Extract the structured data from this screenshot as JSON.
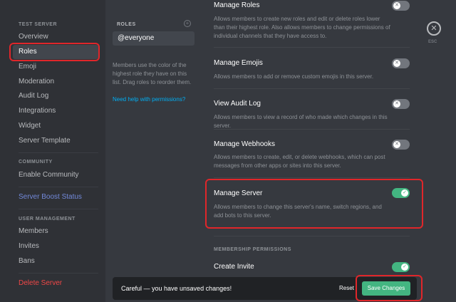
{
  "sidebar": {
    "server_header": "TEST SERVER",
    "items": [
      {
        "label": "Overview"
      },
      {
        "label": "Roles"
      },
      {
        "label": "Emoji"
      },
      {
        "label": "Moderation"
      },
      {
        "label": "Audit Log"
      },
      {
        "label": "Integrations"
      },
      {
        "label": "Widget"
      },
      {
        "label": "Server Template"
      }
    ],
    "community_header": "COMMUNITY",
    "enable_community": "Enable Community",
    "boost_status": "Server Boost Status",
    "user_mgmt_header": "USER MANAGEMENT",
    "user_items": [
      {
        "label": "Members"
      },
      {
        "label": "Invites"
      },
      {
        "label": "Bans"
      }
    ],
    "delete_server": "Delete Server"
  },
  "roles_panel": {
    "header": "ROLES",
    "add_icon": "plus-circle-icon",
    "selected_role": "@everyone",
    "description": "Members use the color of the highest role they have on this list. Drag roles to reorder them.",
    "help_link": "Need help with permissions?"
  },
  "permissions": [
    {
      "title": "Manage Roles",
      "description": "Allows members to create new roles and edit or delete roles lower than their highest role. Also allows members to change permissions of individual channels that they have access to.",
      "enabled": false
    },
    {
      "title": "Manage Emojis",
      "description": "Allows members to add or remove custom emojis in this server.",
      "enabled": false
    },
    {
      "title": "View Audit Log",
      "description": "Allows members to view a record of who made which changes in this server.",
      "enabled": false
    },
    {
      "title": "Manage Webhooks",
      "description": "Allows members to create, edit, or delete webhooks, which can post messages from other apps or sites into this server.",
      "enabled": false
    },
    {
      "title": "Manage Server",
      "description": "Allows members to change this server's name, switch regions, and add bots to this server.",
      "enabled": true
    },
    {
      "title": "Create Invite",
      "description": "",
      "enabled": true
    }
  ],
  "membership_header": "MEMBERSHIP PERMISSIONS",
  "close": {
    "icon": "close-icon",
    "label": "ESC"
  },
  "unsaved_bar": {
    "message": "Careful — you have unsaved changes!",
    "reset_label": "Reset",
    "save_label": "Save Changes"
  },
  "colors": {
    "accent_green": "#43b581",
    "highlight_red": "#e0262a",
    "link_blue": "#00aff4",
    "danger_red": "#f04747"
  }
}
